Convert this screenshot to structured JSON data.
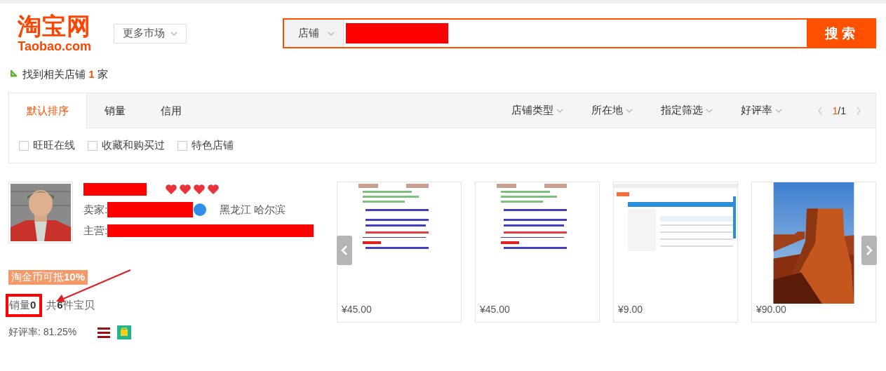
{
  "logo": {
    "title": "淘宝网",
    "domain": "Taobao.com"
  },
  "market_button": {
    "label": "更多市场"
  },
  "search": {
    "scope": "店铺",
    "button": "搜索"
  },
  "result_summary": {
    "text": "找到相关店铺 **1** 家"
  },
  "sort_tabs": [
    {
      "label": "默认排序",
      "selected": true
    },
    {
      "label": "销量",
      "selected": false
    },
    {
      "label": "信用",
      "selected": false
    }
  ],
  "filters": [
    "店铺类型",
    "所在地",
    "指定筛选",
    "好评率"
  ],
  "pager": {
    "current": "1",
    "total": "/1"
  },
  "checkboxes": [
    {
      "label": "旺旺在线",
      "checked": false
    },
    {
      "label": "收藏和购买过",
      "checked": false
    },
    {
      "label": "特色店铺",
      "checked": false
    }
  ],
  "shop": {
    "rating": {
      "stars": 4
    },
    "seller_label": "卖家:",
    "location": "黑龙江 哈尔滨",
    "main_label": "主营:",
    "coin_badge": "淘金币可抵**10%**",
    "sales": "销量**0**",
    "items_count": "共**6**件宝贝",
    "positive_rate": "好评率: 81.25%"
  },
  "products": [
    {
      "kind": "document",
      "price": "¥45.00"
    },
    {
      "kind": "document",
      "price": "¥45.00"
    },
    {
      "kind": "screenshot",
      "price": "¥9.00"
    },
    {
      "kind": "picture",
      "price": "¥90.00"
    }
  ]
}
